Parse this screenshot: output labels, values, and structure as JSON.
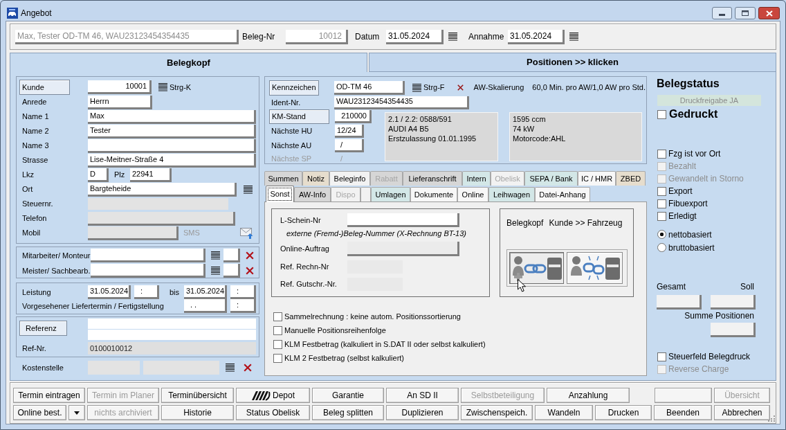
{
  "window": {
    "title": "Angebot"
  },
  "header": {
    "summary": {
      "value": "Max, Tester OD-TM 46, WAU23123454354435",
      "readonly": true
    },
    "fields": [
      {
        "label": "Beleg-Nr",
        "value": "10012",
        "readonly": true,
        "picker": false
      },
      {
        "label": "Datum",
        "value": "31.05.2024",
        "readonly": false,
        "picker": true
      },
      {
        "label": "Annahme",
        "value": "31.05.2024",
        "readonly": false,
        "picker": true
      }
    ]
  },
  "main_tabs": [
    {
      "label": "Belegkopf",
      "selected": true
    },
    {
      "label": "Positionen >> klicken",
      "selected": false
    }
  ],
  "customer": {
    "kunde": {
      "button": "Kunde",
      "value": "10001",
      "shortcut": "Strg-K"
    },
    "anrede": {
      "label": "Anrede",
      "value": "Herrn"
    },
    "names": [
      {
        "label": "Name 1",
        "value": "Max"
      },
      {
        "label": "Name 2",
        "value": "Tester"
      },
      {
        "label": "Name 3"
      },
      {
        "label": "Strasse",
        "value": "Lise-Meitner-Straße 4"
      }
    ],
    "lkz": {
      "label": "Lkz",
      "value": "D"
    },
    "plz": {
      "label": "Plz",
      "value": "22941"
    },
    "ort": {
      "label": "Ort",
      "value": "Bargteheide"
    },
    "steuernr": {
      "label": "Steuernr.",
      "disabled": true
    },
    "telefon": {
      "label": "Telefon",
      "disabled": true
    },
    "mobil": {
      "label": "Mobil",
      "disabled": true,
      "sms": "SMS"
    }
  },
  "staff": [
    {
      "label": "Mitarbeiter/ Monteur"
    },
    {
      "label": "Meister/ Sachbearb."
    }
  ],
  "dates": {
    "leistung": {
      "label": "Leistung",
      "date": "31.05.2024",
      "time": ":",
      "bis": "bis",
      "bis_date": "31.05.2024",
      "bis_time": ":"
    },
    "liefertermin": {
      "label": "Vorgesehener Liefertermin / Fertigstellung",
      "date": ". .",
      "time": ":"
    }
  },
  "reference": {
    "button": "Referenz",
    "ref_nr": {
      "label": "Ref-Nr.",
      "value": "0100010012",
      "disabled": true
    }
  },
  "kostenstelle": {
    "label": "Kostenstelle",
    "disabled": true
  },
  "vehicle": {
    "kennzeichen": {
      "button": "Kennzeichen",
      "value": "OD-TM 46",
      "shortcut": "Strg-F"
    },
    "aw_skalierung": {
      "label": "AW-Skalierung",
      "value": "60,0 Min. pro AW/1,0 AW pro Std."
    },
    "ident": {
      "label": "Ident-Nr.",
      "value": "WAU23123454354435"
    },
    "km": {
      "button": "KM-Stand",
      "value": "210000"
    },
    "inspections": [
      {
        "label": "Nächste HU",
        "value": "12/24",
        "disabled": false
      },
      {
        "label": "Nächste AU",
        "value": "/",
        "disabled": false
      },
      {
        "label": "Nächste SP",
        "value": "/",
        "disabled": true
      }
    ],
    "info": [
      [
        "2.1 / 2.2: 0588/591",
        "AUDI A4 B5",
        "Erstzulassung 01.01.1995"
      ],
      [
        "1595 ccm",
        "74 kW",
        "Motorcode:AHL"
      ]
    ]
  },
  "detail_tabs": [
    [
      {
        "label": "Summen",
        "color": "#d6d6d6",
        "disabled": false,
        "selected": false
      },
      {
        "label": "Notiz",
        "color": "#e6ddcd",
        "disabled": false,
        "selected": false
      },
      {
        "label": "Beleginfo",
        "color": "#f2f2f2",
        "disabled": false,
        "selected": false
      },
      {
        "label": "Rabatt",
        "color": "#d6d6d6",
        "disabled": true,
        "selected": false
      },
      {
        "label": "Lieferanschrift",
        "color": "#d6d6d6",
        "disabled": false,
        "selected": false
      },
      {
        "label": "Intern",
        "color": "#d3e7e7",
        "disabled": false,
        "selected": false
      },
      {
        "label": "Obelisk",
        "color": "#f2f2f2",
        "disabled": true,
        "selected": false
      },
      {
        "label": "SEPA / Bank",
        "color": "#d3e7e7",
        "disabled": false,
        "selected": false
      },
      {
        "label": "IC / HMR",
        "color": "#f7f7f7",
        "disabled": false,
        "selected": false
      },
      {
        "label": "ZBED",
        "color": "#e6ddcd",
        "disabled": false,
        "selected": false
      }
    ],
    [
      {
        "label": "Sonst",
        "color": "#ffffff",
        "disabled": false,
        "selected": true
      },
      {
        "label": "AW-Info",
        "color": "#d6d6d6",
        "disabled": false,
        "selected": false
      },
      {
        "label": "Dispo",
        "color": "#f2f2f2",
        "disabled": true,
        "selected": false
      },
      {
        "color": "#f2f2f2",
        "selected": false
      },
      {
        "label": "Umlagen",
        "color": "#d3e7e7",
        "disabled": false,
        "selected": false
      },
      {
        "label": "Dokumente",
        "color": "#f7f7f7",
        "disabled": false,
        "selected": false
      },
      {
        "label": "Online",
        "color": "#f7f7f7",
        "disabled": false,
        "selected": false
      },
      {
        "label": "Leihwagen",
        "color": "#d3e7e7",
        "disabled": false,
        "selected": false
      },
      {
        "label": "Datei-Anhang",
        "color": "#f7f7f7",
        "disabled": false,
        "selected": false
      }
    ]
  ],
  "sonst": {
    "fields": [
      {
        "label": "L-Schein-Nr",
        "disabled": false
      },
      {
        "label": "Online-Auftrag",
        "disabled": true
      },
      {
        "label": "Ref. Rechn-Nr",
        "disabled": true
      },
      {
        "label": "Ref. Gutschr.-Nr.",
        "disabled": true
      }
    ],
    "note": "externe (Fremd-)Beleg-Nummer (X-Rechnung BT-13)",
    "link_panel": {
      "title": "Belegkopf",
      "subtitle": "Kunde >> Fahrzeug"
    },
    "options": [
      {
        "label": "Sammelrechnung : keine autom. Positionssortierung",
        "checked": false
      },
      {
        "label": "Manuelle Positionsreihenfolge",
        "checked": false
      },
      {
        "label": "KLM Festbetrag (kalkuliert in S.DAT II oder selbst kalkuliert)",
        "checked": false
      },
      {
        "label": "KLM 2 Festbetrag (selbst kalkuliert)",
        "checked": false
      }
    ]
  },
  "status": {
    "title": "Belegstatus",
    "druckfreigabe": "Druckfreigabe JA",
    "gedruckt": {
      "label": "Gedruckt",
      "checked": false
    },
    "flags": [
      {
        "label": "Fzg ist vor Ort",
        "checked": false,
        "disabled": false
      },
      {
        "label": "Bezahlt",
        "checked": false,
        "disabled": true
      },
      {
        "label": "Gewandelt in Storno",
        "checked": false,
        "disabled": true
      },
      {
        "label": "Export",
        "checked": false,
        "disabled": false
      },
      {
        "label": "Fibuexport",
        "checked": false,
        "disabled": false
      },
      {
        "label": "Erledigt",
        "checked": false,
        "disabled": false
      }
    ],
    "basis": [
      {
        "label": "nettobasiert",
        "selected": true
      },
      {
        "label": "bruttobasiert",
        "selected": false
      }
    ],
    "totals": {
      "gesamt": "Gesamt",
      "soll": "Soll",
      "summe": "Summe Positionen"
    },
    "print_flags": [
      {
        "label": "Steuerfeld Belegdruck",
        "checked": false,
        "disabled": false
      },
      {
        "label": "Reverse Charge",
        "checked": false,
        "disabled": true
      }
    ]
  },
  "buttons": [
    [
      {
        "label": "Termin eintragen",
        "kind": "text",
        "disabled": false
      },
      {
        "label": "Termin im Planer",
        "kind": "text",
        "disabled": true
      },
      {
        "label": "Terminübersicht",
        "kind": "text",
        "disabled": false
      },
      {
        "label": "Depot",
        "kind": "icon",
        "disabled": false
      },
      {
        "label": "Garantie",
        "kind": "text",
        "disabled": false
      },
      {
        "label": "An SD II",
        "kind": "text",
        "disabled": false
      },
      {
        "label": "Selbstbeteiligung",
        "kind": "text",
        "disabled": true
      },
      {
        "label": "Anzahlung",
        "kind": "text",
        "disabled": false
      },
      {
        "kind": "text"
      },
      {
        "label": "Übersicht",
        "kind": "text",
        "disabled": true
      }
    ],
    [
      {
        "label": "Online best.",
        "kind": "text",
        "disabled": false
      },
      {
        "kind": "menu",
        "disabled": false
      },
      {
        "label": "nichts archiviert",
        "kind": "text",
        "disabled": true
      },
      {
        "label": "Historie",
        "kind": "text",
        "disabled": false
      },
      {
        "label": "Status Obelisk",
        "kind": "text",
        "disabled": false
      },
      {
        "label": "Beleg splitten",
        "kind": "text",
        "disabled": false
      },
      {
        "label": "Duplizieren",
        "kind": "text",
        "disabled": false
      },
      {
        "label": "Zwischenspeich.",
        "kind": "text",
        "disabled": false
      },
      {
        "label": "Wandeln",
        "kind": "text",
        "disabled": false
      },
      {
        "label": "Drucken",
        "kind": "text",
        "disabled": false
      },
      {
        "label": "Beenden",
        "kind": "text",
        "disabled": false
      },
      {
        "label": "Abbrechen",
        "kind": "text",
        "disabled": false
      }
    ]
  ]
}
